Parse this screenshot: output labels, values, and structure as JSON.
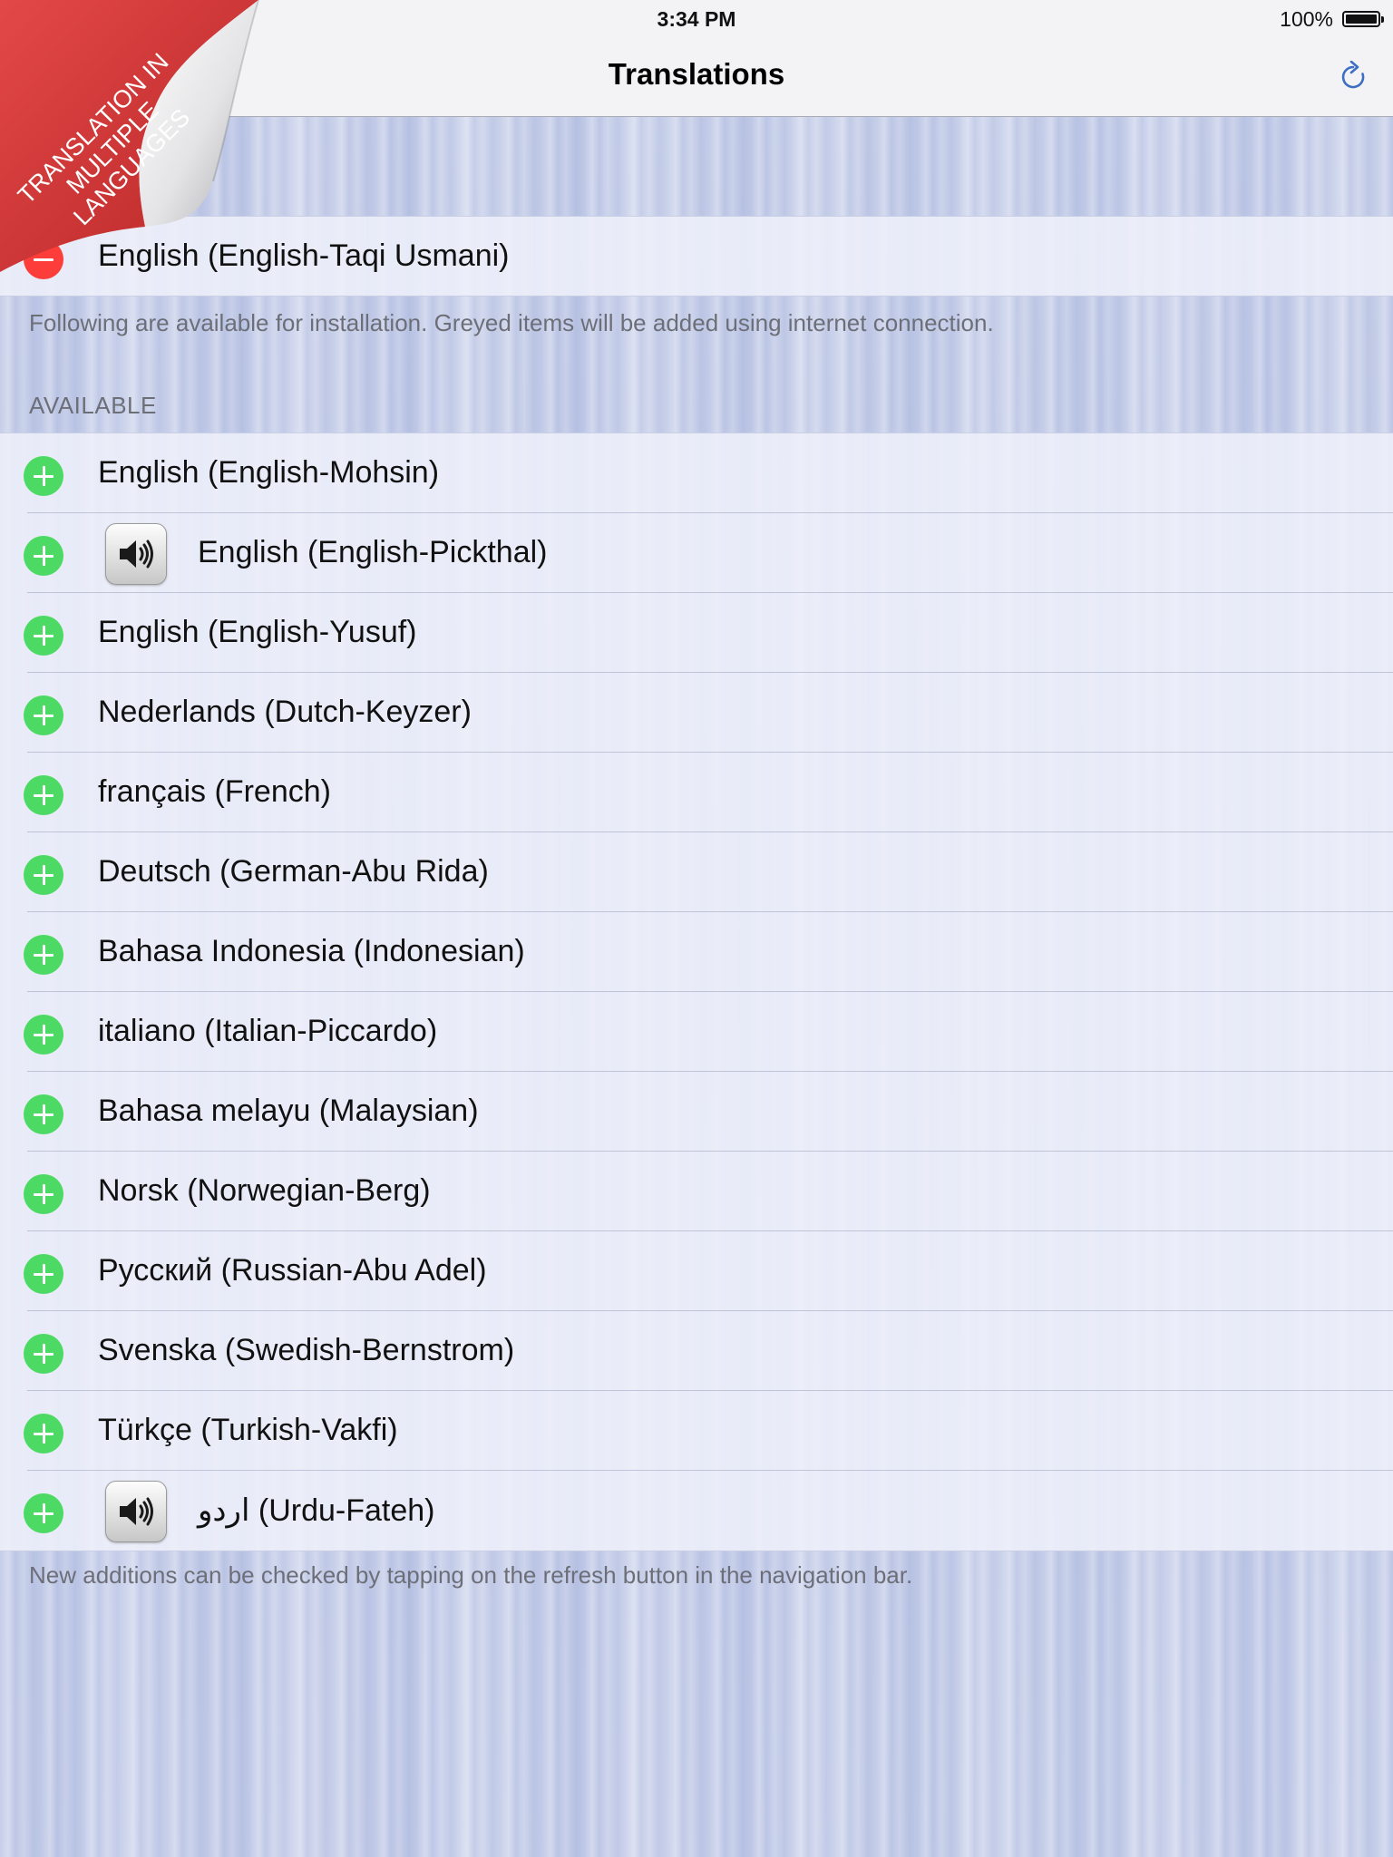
{
  "status_bar": {
    "time": "3:34 PM",
    "battery": "100%"
  },
  "nav": {
    "title": "Translations",
    "refresh_icon": "refresh-icon"
  },
  "ribbon": {
    "line1": "TRANSLATION IN",
    "line2": "MULTIPLE LANGUAGES",
    "color": "#d63a3a"
  },
  "installed": [
    {
      "label": "English (English-Taqi Usmani)",
      "action": "remove"
    }
  ],
  "installed_footer": "Following are available for installation. Greyed items will be added using internet connection.",
  "available_header": "AVAILABLE",
  "available": [
    {
      "label": "English (English-Mohsin)",
      "audio": false
    },
    {
      "label": "English (English-Pickthal)",
      "audio": true
    },
    {
      "label": "English (English-Yusuf)",
      "audio": false
    },
    {
      "label": "Nederlands (Dutch-Keyzer)",
      "audio": false
    },
    {
      "label": "français (French)",
      "audio": false
    },
    {
      "label": "Deutsch (German-Abu Rida)",
      "audio": false
    },
    {
      "label": "Bahasa Indonesia (Indonesian)",
      "audio": false
    },
    {
      "label": "italiano (Italian-Piccardo)",
      "audio": false
    },
    {
      "label": "Bahasa melayu (Malaysian)",
      "audio": false
    },
    {
      "label": "Norsk (Norwegian-Berg)",
      "audio": false
    },
    {
      "label": "Русский (Russian-Abu Adel)",
      "audio": false
    },
    {
      "label": "Svenska (Swedish-Bernstrom)",
      "audio": false
    },
    {
      "label": "Türkçe (Turkish-Vakfi)",
      "audio": false
    },
    {
      "label": "اردو (Urdu-Fateh)",
      "audio": true
    }
  ],
  "available_footer": "New additions can be checked by tapping on the refresh button in the navigation bar.",
  "colors": {
    "add": "#4cd964",
    "remove": "#fc3d39",
    "accent": "#3b6fc4"
  }
}
